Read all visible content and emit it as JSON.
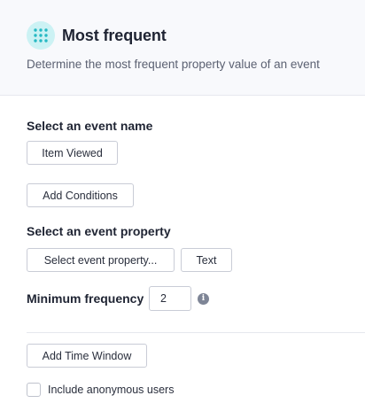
{
  "header": {
    "title": "Most frequent",
    "subtitle": "Determine the most frequent property value of an event",
    "icon": "grid-dots-icon",
    "icon_color": "#26b9c3"
  },
  "event_name": {
    "label": "Select an event name",
    "selected": "Item Viewed"
  },
  "conditions": {
    "button_label": "Add Conditions"
  },
  "event_property": {
    "label": "Select an event property",
    "placeholder": "Select event property...",
    "type": "Text"
  },
  "min_frequency": {
    "label": "Minimum frequency",
    "value": "2",
    "info_icon": "info-icon"
  },
  "time_window": {
    "button_label": "Add Time Window"
  },
  "anonymous": {
    "label": "Include anonymous users",
    "checked": false
  }
}
